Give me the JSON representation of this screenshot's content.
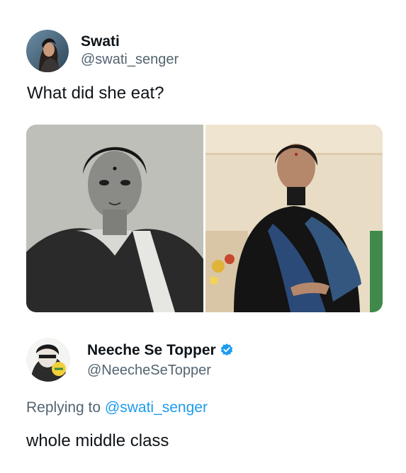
{
  "original_tweet": {
    "author_name": "Swati",
    "author_handle": "@swati_senger",
    "text": "What did she eat?",
    "media": [
      {
        "description_icon": "photo-black-white-portrait"
      },
      {
        "description_icon": "photo-color-portrait"
      }
    ]
  },
  "reply_tweet": {
    "author_name": "Neeche Se Topper",
    "author_handle": "@NeecheSeTopper",
    "verified_icon": "verified-badge-icon",
    "replying_prefix": "Replying to",
    "replying_mention": "@swati_senger",
    "text": "whole middle class"
  },
  "colors": {
    "text_primary": "#0f1419",
    "text_secondary": "#536471",
    "accent": "#1d9bf0"
  }
}
